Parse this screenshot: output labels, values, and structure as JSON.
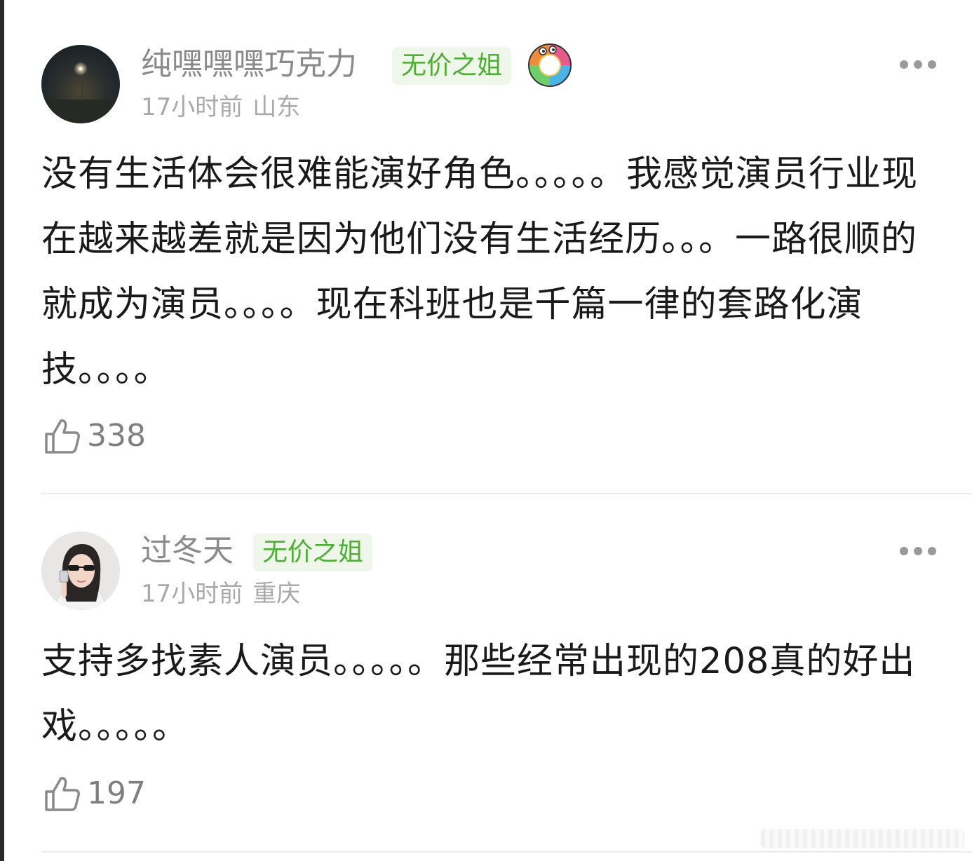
{
  "comments": [
    {
      "username": "纯嘿嘿嘿巧克力",
      "badge": "无价之姐",
      "time": "17小时前",
      "location": "山东",
      "content": "没有生活体会很难能演好角色。。。。。我感觉演员行业现在越来越差就是因为他们没有生活经历。。。一路很顺的就成为演员。。。。现在科班也是千篇一律的套路化演技。。。。",
      "likes": "338",
      "avatar_icon": "night-streetlight-avatar",
      "medal_icon": "rainbow-donut-medal-icon"
    },
    {
      "username": "过冬天",
      "badge": "无价之姐",
      "time": "17小时前",
      "location": "重庆",
      "content": "支持多找素人演员。。。。。那些经常出现的208真的好出戏。。。。。",
      "likes": "197",
      "avatar_icon": "girl-sunglasses-avatar"
    }
  ],
  "colors": {
    "badge_text": "#4fae34",
    "badge_bg": "#eef7ea",
    "username": "#8a8a8a",
    "meta": "#a9a9a9"
  }
}
